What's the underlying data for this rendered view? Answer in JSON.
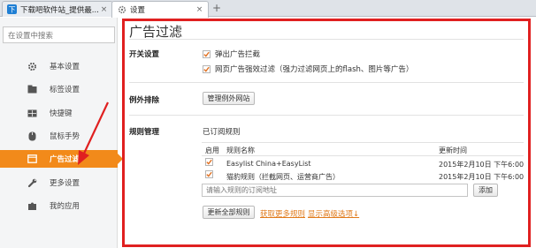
{
  "tabs": [
    {
      "title": "下载吧软件站_提供最...",
      "close": "×"
    },
    {
      "title": "设置",
      "close": "×"
    }
  ],
  "new_tab": "+",
  "sidebar": {
    "search_placeholder": "在设置中搜索",
    "items": [
      {
        "label": "基本设置",
        "icon": "gear-icon"
      },
      {
        "label": "标签设置",
        "icon": "tab-icon"
      },
      {
        "label": "快捷键",
        "icon": "keyboard-icon"
      },
      {
        "label": "鼠标手势",
        "icon": "mouse-icon"
      },
      {
        "label": "广告过滤",
        "icon": "filter-icon"
      },
      {
        "label": "更多设置",
        "icon": "wrench-icon"
      },
      {
        "label": "我的应用",
        "icon": "puzzle-icon"
      }
    ],
    "active_index": 4
  },
  "main": {
    "title": "广告过滤",
    "switch_section": {
      "label": "开关设置",
      "options": [
        {
          "label": "弹出广告拦截",
          "checked": true
        },
        {
          "label": "网页广告强效过滤（强力过滤网页上的flash、图片等广告）",
          "checked": true
        }
      ]
    },
    "exception_section": {
      "label": "例外排除",
      "button": "管理例外网站"
    },
    "rules_section": {
      "label": "规则管理",
      "subtitle": "已订阅规则",
      "columns": {
        "enable": "启用",
        "name": "规则名称",
        "updated": "更新时间"
      },
      "rows": [
        {
          "enabled": true,
          "name": "Easylist China+EasyList",
          "updated": "2015年2月10日 下午6:00:0"
        },
        {
          "enabled": true,
          "name": "猫豹规则（拦截网页、运营商广告）",
          "updated": "2015年2月10日 下午6:00:0"
        }
      ],
      "input_placeholder": "请输入规则的订阅地址",
      "add_button": "添加",
      "update_all_button": "更新全部规则",
      "more_rules_link": "获取更多规则",
      "advanced_link": "显示高级选项↓"
    }
  },
  "colors": {
    "accent": "#f28a1a",
    "annotation": "#e02020"
  }
}
